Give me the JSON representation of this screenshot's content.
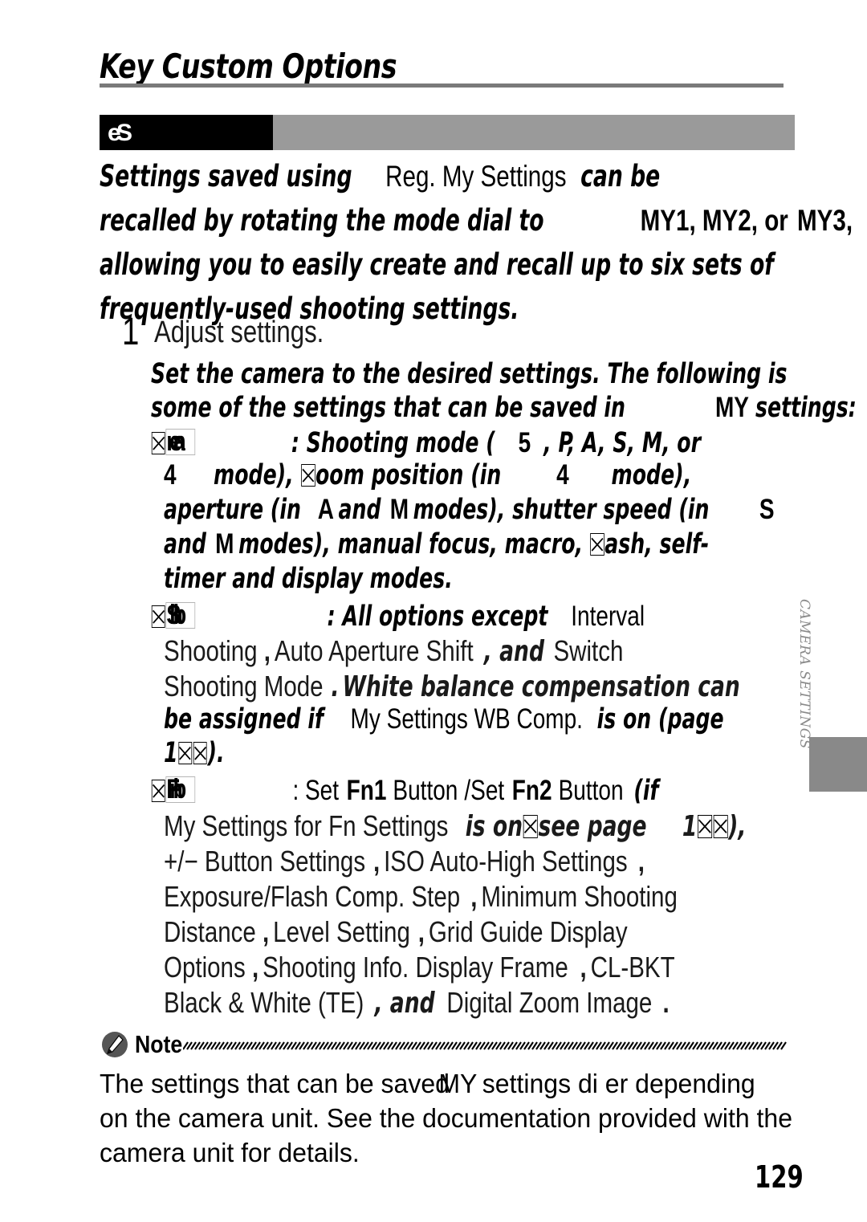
{
  "page": {
    "title": "Key Custom Options",
    "folio": "129",
    "side_tab": "CAMERA SETTINGS",
    "accent_gray": "#9a9a9a",
    "rule_gray": "#7a7a7a",
    "tab_gray": "#898989"
  },
  "banner": {
    "label": "e S",
    "label_glyphs": [
      "e",
      "S"
    ]
  },
  "intro": {
    "line1_a": "Settings saved using",
    "line1_b": "Reg. My Settings",
    "line1_c": "can be",
    "line2_a": "recalled by rotating the mode dial to",
    "line2_b": "MY1, MY2, or",
    "line2_c": "MY3,",
    "line3": "allowing you to easily create and recall up to six sets of",
    "line4": "frequently-used shooting settings."
  },
  "step": {
    "number": "1",
    "heading": "Adjust settings.",
    "body_line1": "Set the camera to the desired settings. The following is",
    "body_line2_a": "some of the settings that can be saved in",
    "body_line2_b": "MY",
    "body_line2_c": "settings:"
  },
  "shooting": {
    "icon_glyphs": [
      "⊠",
      "m",
      "e"
    ],
    "line1_a": ": Shooting mode (",
    "line1_num": "5",
    "line1_b": ", P, A, S, M, or",
    "line2_num": "4",
    "line2_a": "mode), ",
    "line2_tofu": "z",
    "line2_b": "oom position (in",
    "line2_num2": "4",
    "line2_c": "mode),",
    "line3_a": "aperture (in",
    "line3_A": "A",
    "line3_b": "and",
    "line3_M": "M",
    "line3_c": "modes), shutter speed (in",
    "line3_S": "S",
    "line4_a": "and",
    "line4_M": "M",
    "line4_b": "modes), manual focus, macro, ",
    "line4_tofu": "fl",
    "line4_c": "ash, self-",
    "line5": "timer and display modes."
  },
  "options": {
    "icon_glyphs": [
      "⊠",
      "Sh",
      "b"
    ],
    "line1_a": ": All options except",
    "line1_b": "Interval",
    "line2_a": "Shooting",
    "line2_comma": ",",
    "line2_b": "Auto Aperture Shift",
    "line2_and": ", and",
    "line2_c": "Switch",
    "line3_a": "Shooting Mode",
    "line3_period": ".",
    "line3_b": "White balance compensation can",
    "line4_a": "be assigned if",
    "line4_b": "My Settings WB Comp.",
    "line4_c": "is on (page",
    "line5_num": "1",
    "line5_tail": ")."
  },
  "fnbuttons": {
    "icon_glyphs": [
      "⊠",
      "Fn",
      "b"
    ],
    "line1_a": ": Set",
    "line1_fn1": "Fn1",
    "line1_b": "Button",
    "line1_slash": "/Set",
    "line1_fn2": "Fn2",
    "line1_c": "Button",
    "line1_d": "(if",
    "line2_a": "My Settings for Fn Settings",
    "line2_b": "is on",
    "line2_c": "see page",
    "line2_num": "1",
    "line2_tail": "),",
    "line3_a": "+/− Button Settings",
    "line3_c1": ",",
    "line3_b": "ISO Auto-High Settings",
    "line3_c2": ",",
    "line4_a": "Exposure/Flash Comp. Step",
    "line4_c1": ",",
    "line4_b": "Minimum Shooting",
    "line5_a": "Distance",
    "line5_c1": ",",
    "line5_b": "Level Setting",
    "line5_c2": ",",
    "line5_c": "Grid Guide Display",
    "line6_a": "Options",
    "line6_c1": ",",
    "line6_b": "Shooting Info. Display Frame",
    "line6_c2": ",",
    "line6_c": "CL-BKT",
    "line7_a": "Black & White (TE)",
    "line7_and": ", and",
    "line7_b": "Digital Zoom Image",
    "line7_period": "."
  },
  "note": {
    "label": "Note",
    "icon": "note-pencil-icon",
    "line1_a": "The settings that can be saved",
    "line1_overlap": "MY",
    "line1_b": " settings di er depending",
    "line2": "on the camera unit. See the documentation provided with the",
    "line3": "camera unit for details."
  }
}
